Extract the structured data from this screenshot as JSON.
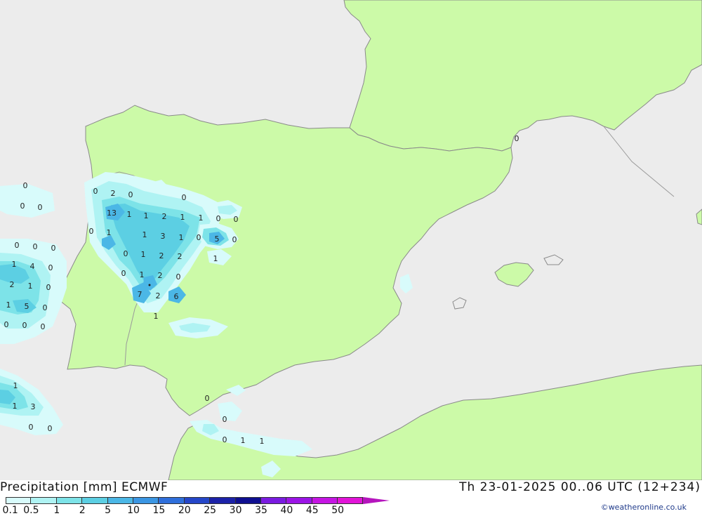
{
  "map": {
    "title": "Precipitation [mm] ECMWF",
    "valid_time": "Th 23-01-2025 00..06 UTC (12+234)",
    "credit": "©weatheronline.co.uk",
    "colors": {
      "sea": "#ececec",
      "land": "#ccfaa8",
      "coast": "#8a8a8a"
    },
    "legend": {
      "ticks": [
        "0.1",
        "0.5",
        "1",
        "2",
        "5",
        "10",
        "15",
        "20",
        "25",
        "30",
        "35",
        "40",
        "45",
        "50"
      ],
      "colors": [
        "#d8fbfb",
        "#aff3f3",
        "#7de3e8",
        "#5ccfe3",
        "#4bb7e6",
        "#3b96e3",
        "#2f6fdb",
        "#2546c8",
        "#1c22a8",
        "#0f0f90",
        "#7a1be0",
        "#9b14e6",
        "#c515e3",
        "#e214d8",
        "#b515bd"
      ]
    },
    "values": [
      {
        "t": "0"
      },
      {
        "t": "0"
      },
      {
        "t": "0"
      },
      {
        "t": "0"
      },
      {
        "t": "2"
      },
      {
        "t": "0"
      },
      {
        "t": "0"
      },
      {
        "t": "13"
      },
      {
        "t": "1"
      },
      {
        "t": "1"
      },
      {
        "t": "2"
      },
      {
        "t": "1"
      },
      {
        "t": "1"
      },
      {
        "t": "0"
      },
      {
        "t": "0"
      },
      {
        "t": "0"
      },
      {
        "t": "1"
      },
      {
        "t": "1"
      },
      {
        "t": "3"
      },
      {
        "t": "1"
      },
      {
        "t": "0"
      },
      {
        "t": "5"
      },
      {
        "t": "0"
      },
      {
        "t": "0"
      },
      {
        "t": "0"
      },
      {
        "t": "0"
      },
      {
        "t": "0"
      },
      {
        "t": "1"
      },
      {
        "t": "2"
      },
      {
        "t": "2"
      },
      {
        "t": "1"
      },
      {
        "t": "1"
      },
      {
        "t": "4"
      },
      {
        "t": "0"
      },
      {
        "t": "0"
      },
      {
        "t": "1"
      },
      {
        "t": "2"
      },
      {
        "t": "0"
      },
      {
        "t": "2"
      },
      {
        "t": "1"
      },
      {
        "t": "0"
      },
      {
        "t": "7"
      },
      {
        "t": "2"
      },
      {
        "t": "6"
      },
      {
        "t": "1"
      },
      {
        "t": "5"
      },
      {
        "t": "0"
      },
      {
        "t": "1"
      },
      {
        "t": "0"
      },
      {
        "t": "0"
      },
      {
        "t": "0"
      },
      {
        "t": "1"
      },
      {
        "t": "1"
      },
      {
        "t": "3"
      },
      {
        "t": "0"
      },
      {
        "t": "0"
      },
      {
        "t": "0"
      },
      {
        "t": "0"
      },
      {
        "t": "0"
      },
      {
        "t": "1"
      },
      {
        "t": "1"
      },
      {
        "t": "0"
      }
    ]
  }
}
